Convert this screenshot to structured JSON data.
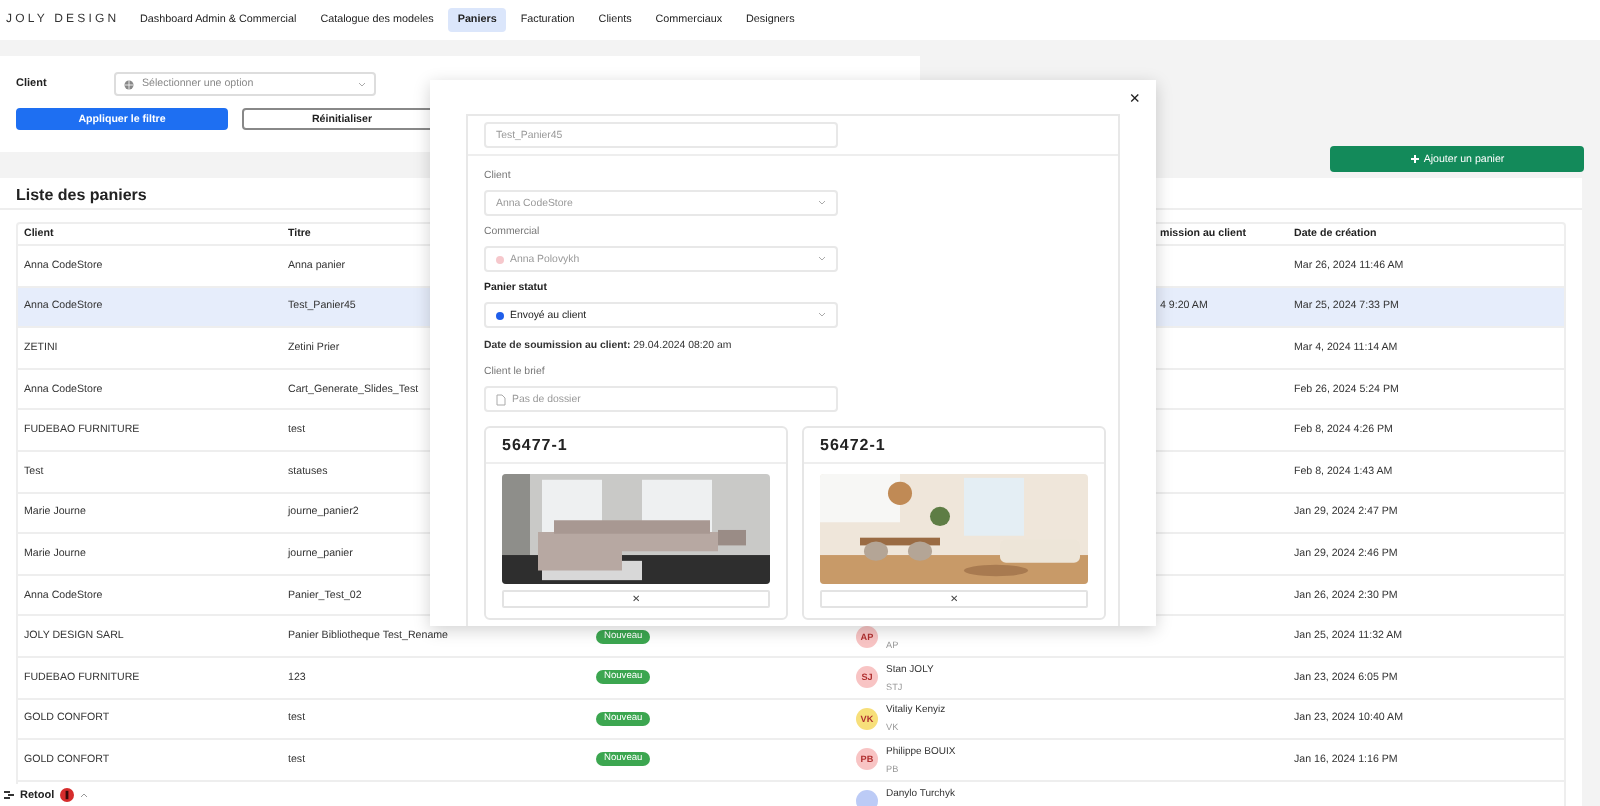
{
  "brand": "JOLY DESIGN",
  "nav": [
    {
      "label": "Dashboard Admin & Commercial",
      "selected": false
    },
    {
      "label": "Catalogue des modeles",
      "selected": false
    },
    {
      "label": "Paniers",
      "selected": true
    },
    {
      "label": "Facturation",
      "selected": false
    },
    {
      "label": "Clients",
      "selected": false
    },
    {
      "label": "Commerciaux",
      "selected": false
    },
    {
      "label": "Designers",
      "selected": false
    }
  ],
  "filter": {
    "label": "Client",
    "placeholder": "Sélectionner une option",
    "apply": "Appliquer le filtre",
    "reset": "Réinitialiser"
  },
  "add_button": "Ajouter un panier",
  "list": {
    "title": "Liste des paniers",
    "columns": {
      "client": "Client",
      "titre": "Titre",
      "submission": "mission au client",
      "created": "Date de création"
    },
    "rows": [
      {
        "client": "Anna CodeStore",
        "titre": "Anna panier",
        "created": "Mar 26, 2024 11:46 AM",
        "selected": false
      },
      {
        "client": "Anna CodeStore",
        "titre": "Test_Panier45",
        "submission": "4 9:20 AM",
        "created": "Mar 25, 2024 7:33 PM",
        "selected": true
      },
      {
        "client": "ZETINI",
        "titre": "Zetini Prier",
        "created": "Mar 4, 2024 11:14 AM",
        "selected": false
      },
      {
        "client": "Anna CodeStore",
        "titre": "Cart_Generate_Slides_Test",
        "created": "Feb 26, 2024 5:24 PM",
        "selected": false
      },
      {
        "client": "FUDEBAO FURNITURE",
        "titre": "test",
        "created": "Feb 8, 2024 4:26 PM",
        "selected": false
      },
      {
        "client": "Test",
        "titre": "statuses",
        "created": "Feb 8, 2024 1:43 AM",
        "selected": false
      },
      {
        "client": "Marie Journe",
        "titre": "journe_panier2",
        "created": "Jan 29, 2024 2:47 PM",
        "selected": false
      },
      {
        "client": "Marie Journe",
        "titre": "journe_panier",
        "created": "Jan 29, 2024 2:46 PM",
        "selected": false
      },
      {
        "client": "Anna CodeStore",
        "titre": "Panier_Test_02",
        "created": "Jan 26, 2024 2:30 PM",
        "selected": false
      },
      {
        "client": "JOLY DESIGN SARL",
        "titre": "Panier Bibliotheque Test_Rename",
        "status": "Nouveau",
        "commercial": {
          "initials": "AP",
          "short": "AP",
          "color": "#f8c4c4"
        },
        "created": "Jan 25, 2024 11:32 AM",
        "selected": false
      },
      {
        "client": "FUDEBAO FURNITURE",
        "titre": "123",
        "status": "Nouveau",
        "commercial": {
          "initials": "SJ",
          "name": "Stan JOLY",
          "short": "STJ",
          "color": "#f8c4c4"
        },
        "created": "Jan 23, 2024 6:05 PM",
        "selected": false
      },
      {
        "client": "GOLD CONFORT",
        "titre": "test",
        "status": "Nouveau",
        "commercial": {
          "initials": "VK",
          "name": "Vitaliy Kenyiz",
          "short": "VK",
          "color": "#f7df7a"
        },
        "created": "Jan 23, 2024 10:40 AM",
        "selected": false
      },
      {
        "client": "GOLD CONFORT",
        "titre": "test",
        "status": "Nouveau",
        "commercial": {
          "initials": "PB",
          "name": "Philippe BOUIX",
          "short": "PB",
          "color": "#f8c4c4"
        },
        "created": "Jan 16, 2024 1:16 PM",
        "selected": false
      },
      {
        "commercial": {
          "name": "Danylo Turchyk",
          "color": "#bccbf6"
        },
        "selected": false
      }
    ]
  },
  "modal": {
    "close": "×",
    "name_value": "Test_Panier45",
    "client_label": "Client",
    "client_value": "Anna CodeStore",
    "commercial_label": "Commercial",
    "commercial_value": "Anna Polovykh",
    "status_label": "Panier statut",
    "status_value": "Envoyé au client",
    "submission": "**Date de soumission au client:** 29.04.2024 08:20 am",
    "brief_label": "Client le brief",
    "brief_placeholder": "Pas de dossier",
    "products": [
      {
        "code": "56477-1",
        "remove": "✕",
        "kind": "sofa"
      },
      {
        "code": "56472-1",
        "remove": "✕",
        "kind": "dining"
      }
    ]
  },
  "footer": {
    "label": "Retool"
  }
}
